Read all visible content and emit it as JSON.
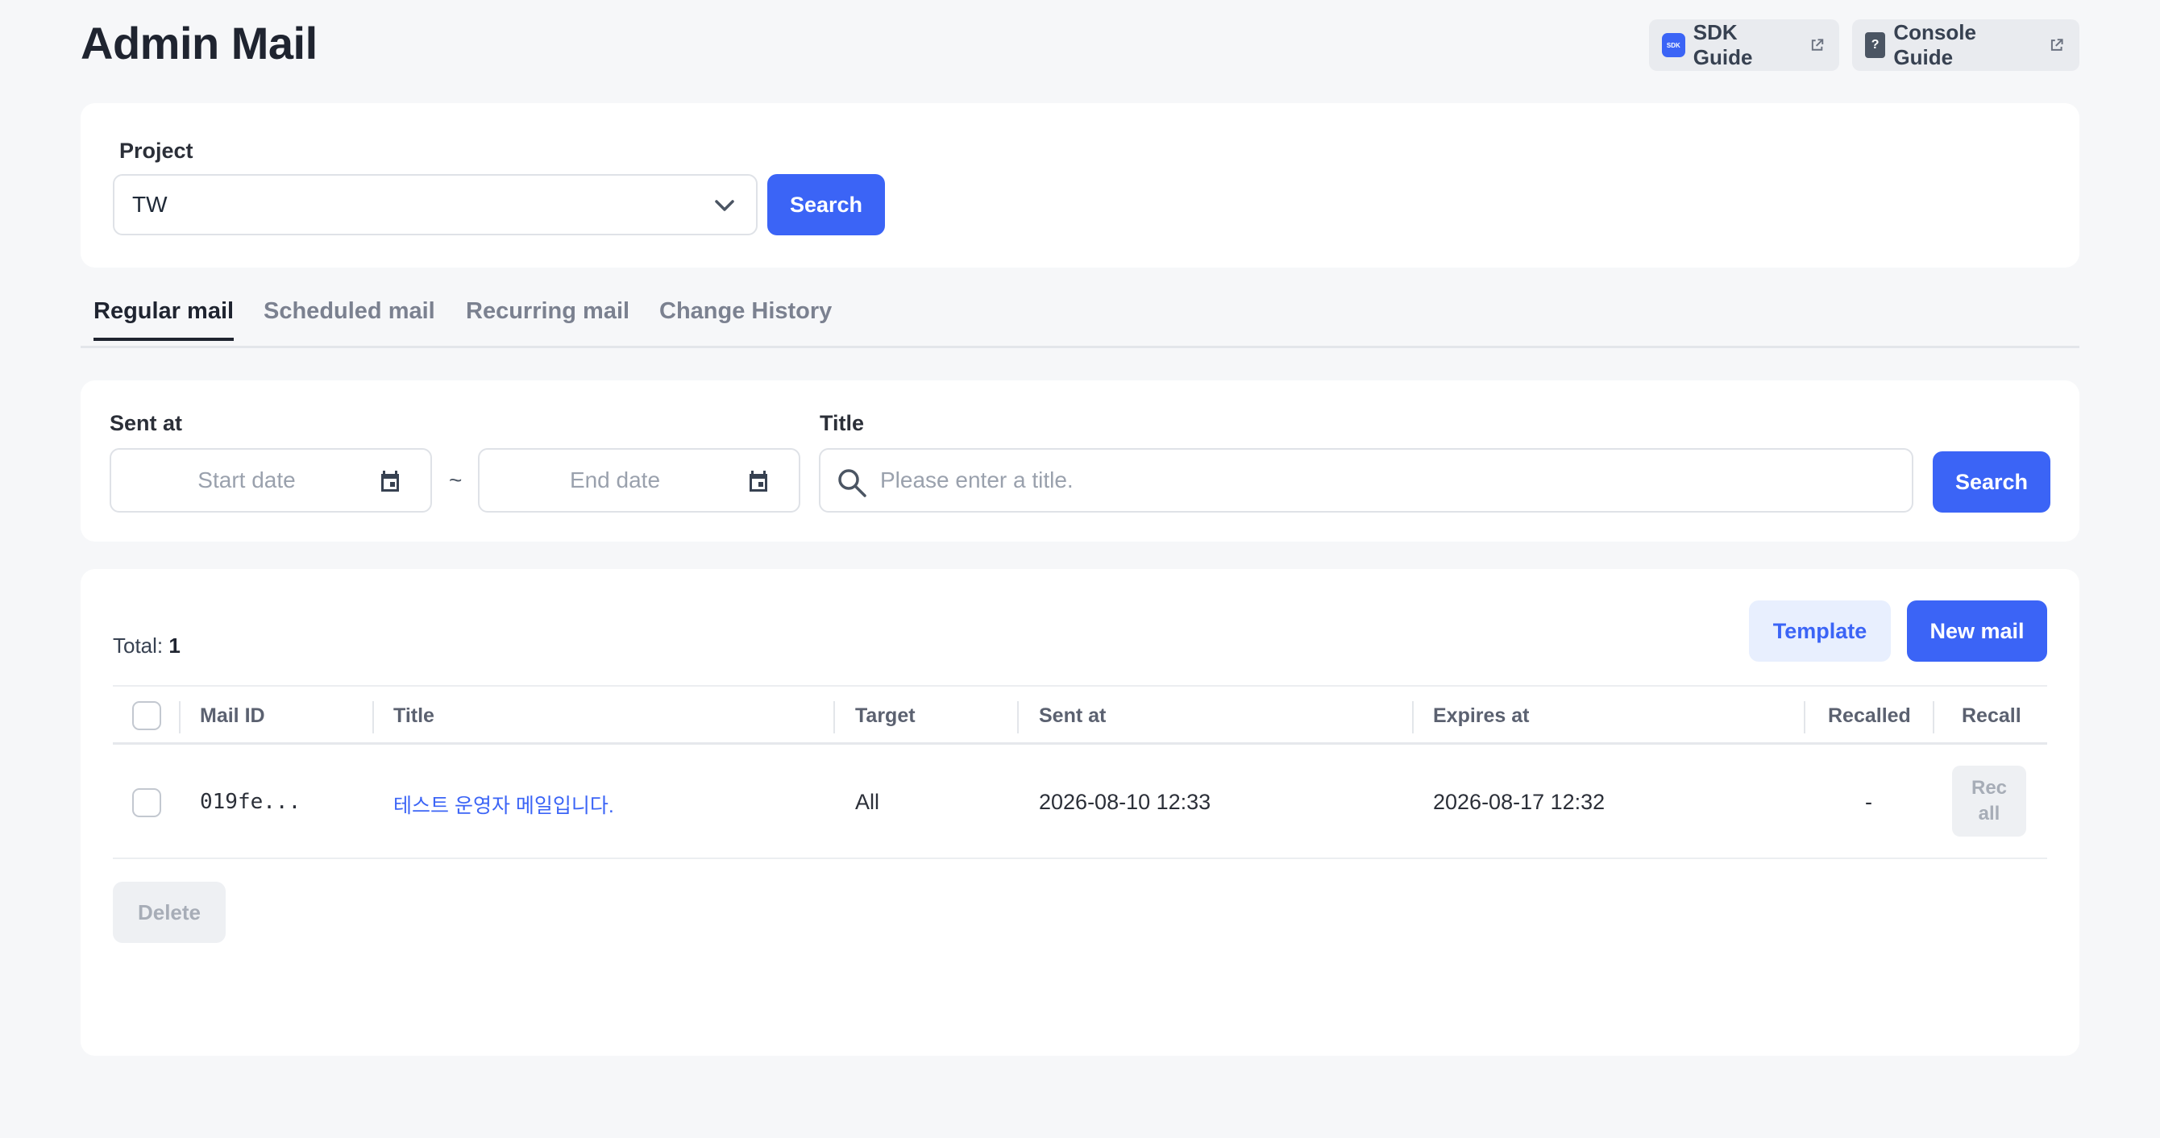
{
  "header": {
    "title": "Admin Mail",
    "sdk_guide_label": "SDK Guide",
    "sdk_badge": "SDK",
    "console_guide_label": "Console Guide",
    "console_badge": "?"
  },
  "project": {
    "label": "Project",
    "selected": "TW",
    "search_label": "Search"
  },
  "tabs": [
    {
      "label": "Regular mail",
      "active": true
    },
    {
      "label": "Scheduled mail",
      "active": false
    },
    {
      "label": "Recurring mail",
      "active": false
    },
    {
      "label": "Change History",
      "active": false
    }
  ],
  "filter": {
    "sent_at_label": "Sent at",
    "start_placeholder": "Start date",
    "end_placeholder": "End date",
    "range_sep": "~",
    "title_label": "Title",
    "title_placeholder": "Please enter a title.",
    "search_label": "Search"
  },
  "list": {
    "total_label": "Total:",
    "total_count": "1",
    "template_label": "Template",
    "new_mail_label": "New mail",
    "delete_label": "Delete",
    "columns": [
      "Mail ID",
      "Title",
      "Target",
      "Sent at",
      "Expires at",
      "Recalled",
      "Recall"
    ],
    "rows": [
      {
        "mail_id": "019fe...",
        "title": "테스트 운영자 메일입니다.",
        "target": "All",
        "sent_at": "2026-08-10 12:33",
        "expires_at": "2026-08-17 12:32",
        "recalled": "-",
        "recall_label_1": "Rec",
        "recall_label_2": "all"
      }
    ]
  },
  "colors": {
    "primary": "#3b64f6",
    "background": "#f6f7f9",
    "card": "#ffffff"
  }
}
